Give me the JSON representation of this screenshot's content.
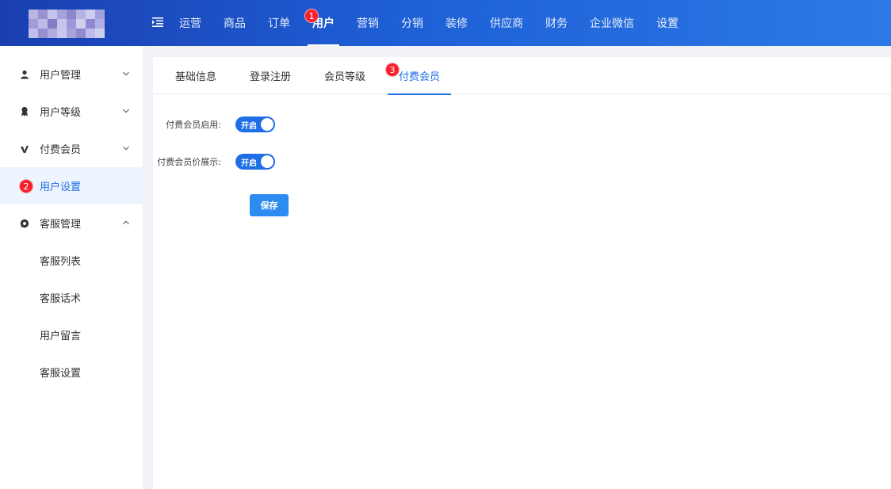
{
  "topbar": {
    "nav": [
      {
        "label": "运营"
      },
      {
        "label": "商品"
      },
      {
        "label": "订单"
      },
      {
        "label": "用户",
        "active": true
      },
      {
        "label": "营销"
      },
      {
        "label": "分销"
      },
      {
        "label": "装修"
      },
      {
        "label": "供应商"
      },
      {
        "label": "财务"
      },
      {
        "label": "企业微信"
      },
      {
        "label": "设置"
      }
    ]
  },
  "badges": {
    "one": "1",
    "two": "2",
    "three": "3"
  },
  "sidebar": {
    "items": [
      {
        "label": "用户管理",
        "icon": "user-icon"
      },
      {
        "label": "用户等级",
        "icon": "medal-icon"
      },
      {
        "label": "付费会员",
        "icon": "vip-icon"
      },
      {
        "label": "用户设置",
        "active": true
      },
      {
        "label": "客服管理",
        "icon": "chat-icon"
      }
    ],
    "sub_items": [
      {
        "label": "客服列表"
      },
      {
        "label": "客服话术"
      },
      {
        "label": "用户留言"
      },
      {
        "label": "客服设置"
      }
    ]
  },
  "tabs": [
    {
      "label": "基础信息"
    },
    {
      "label": "登录注册"
    },
    {
      "label": "会员等级"
    },
    {
      "label": "付费会员",
      "active": true
    }
  ],
  "form": {
    "enable_label": "付费会员启用:",
    "enable_value": "开启",
    "price_label": "付费会员价展示:",
    "price_value": "开启",
    "save_label": "保存"
  },
  "colors": {
    "primary": "#1e6fe6",
    "badge": "#f5222d",
    "button": "#2d8cf0"
  }
}
